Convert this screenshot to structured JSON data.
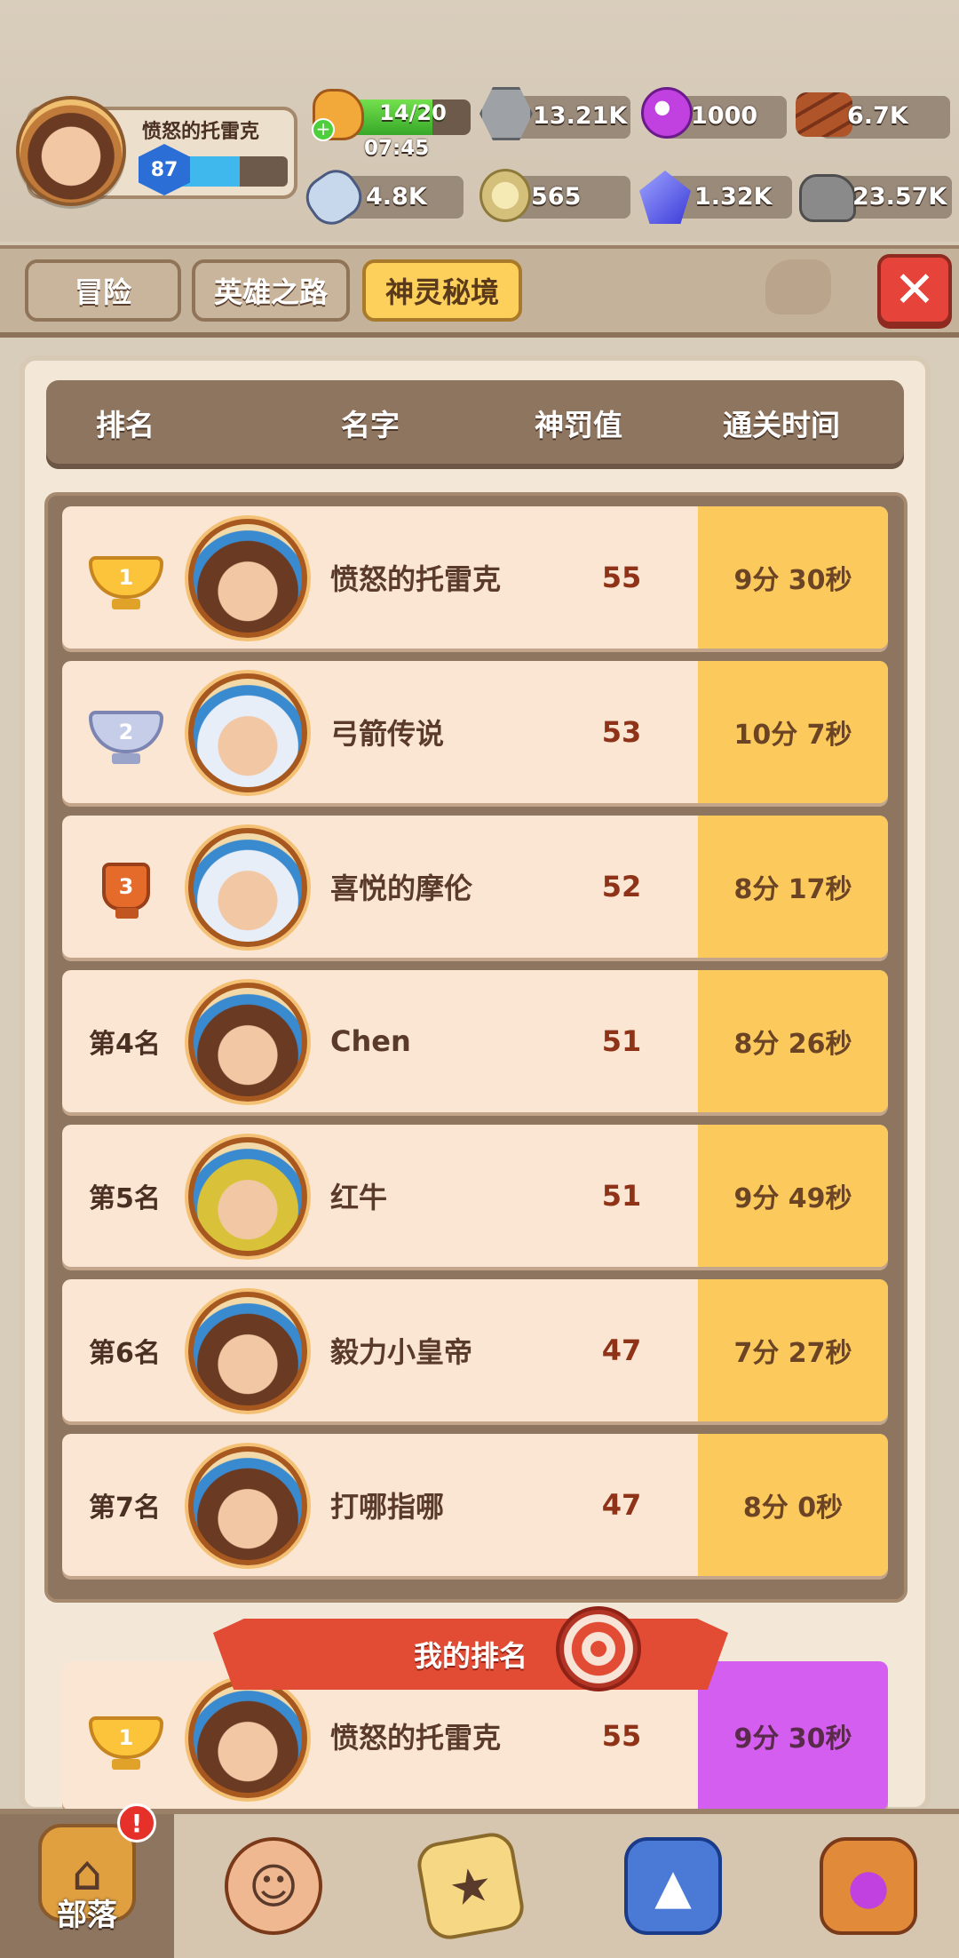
{
  "player": {
    "name": "愤怒的托雷克",
    "level": "87",
    "level_progress": 0.58
  },
  "stamina": {
    "text": "14/20",
    "timer": "07:45",
    "progress": 0.7
  },
  "resources": {
    "ore": "13.21K",
    "orb": "1000",
    "wood": "6.7K",
    "bone": "4.8K",
    "shell": "565",
    "gem": "1.32K",
    "stone": "23.57K"
  },
  "tabs": [
    {
      "label": "冒险",
      "active": false
    },
    {
      "label": "英雄之路",
      "active": false
    },
    {
      "label": "神灵秘境",
      "active": true
    }
  ],
  "table": {
    "headers": {
      "rank": "排名",
      "name": "名字",
      "penalty": "神罚值",
      "time": "通关时间"
    },
    "rows": [
      {
        "rank": "1",
        "name": "愤怒的托雷克",
        "score": "55",
        "time": "9分 30秒",
        "avatar_color": "#6b3a22"
      },
      {
        "rank": "2",
        "name": "弓箭传说",
        "score": "53",
        "time": "10分 7秒",
        "avatar_color": "#e8eef8"
      },
      {
        "rank": "3",
        "name": "喜悦的摩伦",
        "score": "52",
        "time": "8分 17秒",
        "avatar_color": "#e8eef8"
      },
      {
        "rank": "第4名",
        "name": "Chen",
        "score": "51",
        "time": "8分 26秒",
        "avatar_color": "#6b3a22"
      },
      {
        "rank": "第5名",
        "name": "红牛",
        "score": "51",
        "time": "9分 49秒",
        "avatar_color": "#d9c23a"
      },
      {
        "rank": "第6名",
        "name": "毅力小皇帝",
        "score": "47",
        "time": "7分 27秒",
        "avatar_color": "#6b3a22"
      },
      {
        "rank": "第7名",
        "name": "打哪指哪",
        "score": "47",
        "time": "8分 0秒",
        "avatar_color": "#6b3a22"
      }
    ]
  },
  "my_rank": {
    "banner": "我的排名",
    "rank": "1",
    "name": "愤怒的托雷克",
    "score": "55",
    "time": "9分 30秒"
  },
  "bottom_nav": {
    "tribe_label": "部落",
    "alert": "!"
  }
}
